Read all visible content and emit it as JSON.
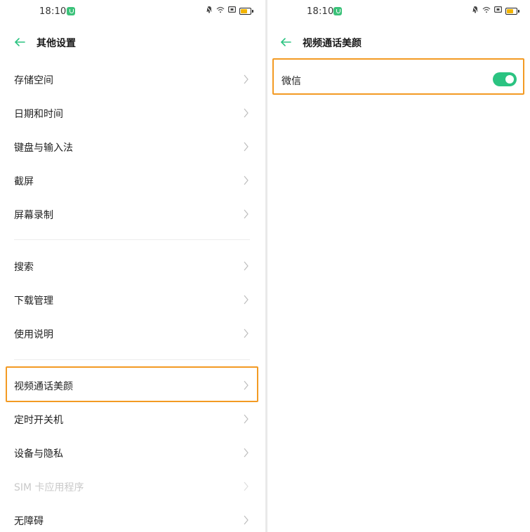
{
  "left": {
    "status": {
      "time": "18:10"
    },
    "header": {
      "title": "其他设置"
    },
    "items": [
      {
        "label": "存储空间"
      },
      {
        "label": "日期和时间"
      },
      {
        "label": "键盘与输入法"
      },
      {
        "label": "截屏"
      },
      {
        "label": "屏幕录制"
      },
      {
        "label": "搜索"
      },
      {
        "label": "下载管理"
      },
      {
        "label": "使用说明"
      },
      {
        "label": "视频通话美颜"
      },
      {
        "label": "定时开关机"
      },
      {
        "label": "设备与隐私"
      },
      {
        "label": "SIM 卡应用程序",
        "disabled": true
      },
      {
        "label": "无障碍"
      }
    ],
    "highlighted_item": "视频通话美颜"
  },
  "right": {
    "status": {
      "time": "18:10"
    },
    "header": {
      "title": "视频通话美颜"
    },
    "items": [
      {
        "label": "微信",
        "toggle": "on"
      }
    ]
  },
  "colors": {
    "accent": "#2bc381",
    "highlight_border": "#f39a23",
    "disabled_text": "#c9c9c9",
    "battery": "#f2b400"
  },
  "icons": {
    "back": "arrow-left-icon",
    "chevron": "chevron-right-icon",
    "status_app": "phone-call-icon",
    "status_mute": "bell-mute-icon",
    "status_wifi": "wifi-icon",
    "status_sim": "sim-icon",
    "status_battery": "battery-icon"
  }
}
